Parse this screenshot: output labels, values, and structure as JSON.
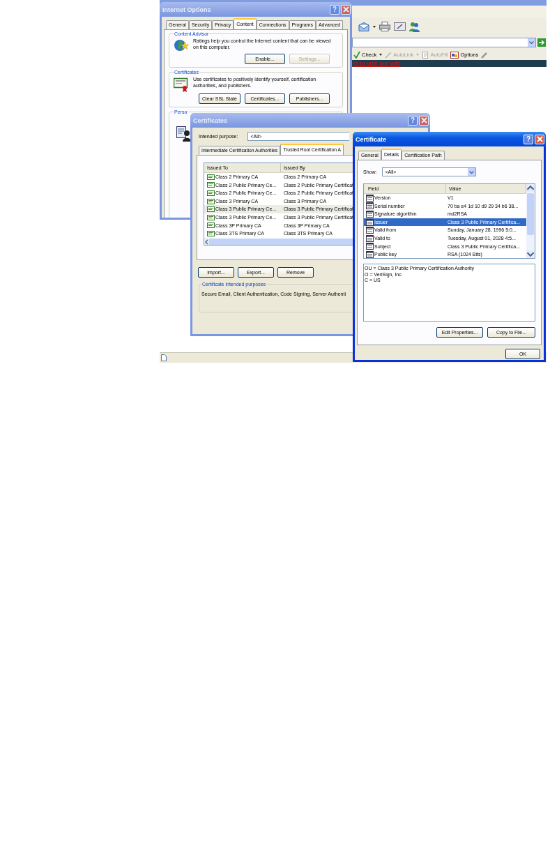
{
  "browser": {
    "toolbar": [
      {
        "label": "Check",
        "disabled": false
      },
      {
        "label": "AutoLink",
        "disabled": true
      },
      {
        "label": "AutoFill",
        "disabled": true
      },
      {
        "label": "Options",
        "disabled": false
      }
    ],
    "banner_link": "nt to visit our wiki"
  },
  "internet_options": {
    "title": "Internet Options",
    "active": false,
    "help_button": "?",
    "tabs": [
      {
        "label": "General",
        "selected": false
      },
      {
        "label": "Security",
        "selected": false
      },
      {
        "label": "Privacy",
        "selected": false
      },
      {
        "label": "Content",
        "selected": true
      },
      {
        "label": "Connections",
        "selected": false
      },
      {
        "label": "Programs",
        "selected": false
      },
      {
        "label": "Advanced",
        "selected": false
      }
    ],
    "content_advisor": {
      "title": "Content Advisor",
      "text": "Ratings help you control the Internet content that can be viewed on this computer.",
      "buttons": [
        {
          "label": "Enable...",
          "disabled": false
        },
        {
          "label": "Settings...",
          "disabled": true
        }
      ]
    },
    "certificates": {
      "title": "Certificates",
      "text": "Use certificates to positively identify yourself, certification authorities, and publishers.",
      "buttons": [
        {
          "label": "Clear SSL State",
          "disabled": false
        },
        {
          "label": "Certificates...",
          "disabled": false
        },
        {
          "label": "Publishers...",
          "disabled": false
        }
      ]
    },
    "personal": {
      "title": "Perso"
    }
  },
  "certificates_dialog": {
    "title": "Certificates",
    "active": false,
    "help_button": "?",
    "purpose_label": "Intended purpose:",
    "purpose_value": "<All>",
    "tabs": [
      {
        "label": "Intermediate Certification Authorities",
        "selected": false
      },
      {
        "label": "Trusted Root Certification A",
        "selected": true
      }
    ],
    "columns": [
      "Issued To",
      "Issued By"
    ],
    "rows": [
      {
        "issued_to": "Class 2 Primary CA",
        "issued_by": "Class 2 Primary CA",
        "selected": false
      },
      {
        "issued_to": "Class 2 Public Primary Ce...",
        "issued_by": "Class 2 Public Primary Certificat",
        "selected": false
      },
      {
        "issued_to": "Class 2 Public Primary Ce...",
        "issued_by": "Class 2 Public Primary Certificat",
        "selected": false
      },
      {
        "issued_to": "Class 3 Primary CA",
        "issued_by": "Class 3 Primary CA",
        "selected": false
      },
      {
        "issued_to": "Class 3 Public Primary Ce...",
        "issued_by": "Class 3 Public Primary Certificat",
        "selected": true
      },
      {
        "issued_to": "Class 3 Public Primary Ce...",
        "issued_by": "Class 3 Public Primary Certificat",
        "selected": false
      },
      {
        "issued_to": "Class 3P Primary CA",
        "issued_by": "Class 3P Primary CA",
        "selected": false
      },
      {
        "issued_to": "Class 3TS Primary CA",
        "issued_by": "Class 3TS Primary CA",
        "selected": false
      }
    ],
    "buttons": [
      {
        "label": "Import..."
      },
      {
        "label": "Export..."
      },
      {
        "label": "Remove"
      }
    ],
    "purposes": {
      "title": "Certificate intended purposes",
      "text": "Secure Email, Client Authentication, Code Signing, Server Authenti"
    }
  },
  "certificate_dialog": {
    "title": "Certificate",
    "active": true,
    "help_button": "?",
    "tabs": [
      {
        "label": "General",
        "selected": false
      },
      {
        "label": "Details",
        "selected": true
      },
      {
        "label": "Certification Path",
        "selected": false
      }
    ],
    "show_label": "Show:",
    "show_value": "<All>",
    "columns": [
      "Field",
      "Value"
    ],
    "fields": [
      {
        "field": "Version",
        "value": "V1",
        "selected": false
      },
      {
        "field": "Serial number",
        "value": "70 ba e4 1d 10 d9 29 34 b6 38...",
        "selected": false
      },
      {
        "field": "Signature algorithm",
        "value": "md2RSA",
        "selected": false
      },
      {
        "field": "Issuer",
        "value": "Class 3 Public Primary Certifica...",
        "selected": true
      },
      {
        "field": "Valid from",
        "value": "Sunday, January 28, 1996 5:0...",
        "selected": false
      },
      {
        "field": "Valid to",
        "value": "Tuesday, August 01, 2028 4:5...",
        "selected": false
      },
      {
        "field": "Subject",
        "value": "Class 3 Public Primary Certifica...",
        "selected": false
      },
      {
        "field": "Public key",
        "value": "RSA (1024 Bits)",
        "selected": false
      }
    ],
    "detail_lines": [
      "OU = Class 3 Public Primary Certification Authority",
      "O = VeriSign, Inc.",
      "C = US"
    ],
    "buttons": [
      {
        "label": "Edit Properties..."
      },
      {
        "label": "Copy to File..."
      }
    ],
    "ok_button": "OK"
  }
}
